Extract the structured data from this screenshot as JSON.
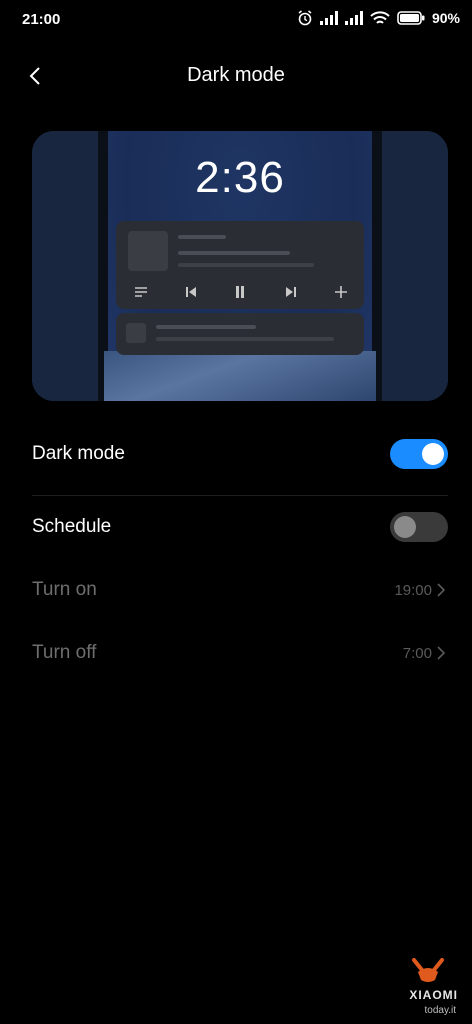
{
  "status_bar": {
    "time": "21:00",
    "battery_percent": "90%",
    "icons": [
      "alarm-icon",
      "signal-icon",
      "signal-icon",
      "wifi-icon",
      "battery-icon"
    ]
  },
  "header": {
    "title": "Dark mode",
    "back_icon": "chevron-left-icon"
  },
  "preview": {
    "clock": "2:36",
    "media_controls": [
      "playlist-icon",
      "previous-icon",
      "pause-icon",
      "next-icon",
      "plus-icon"
    ]
  },
  "settings": {
    "dark_mode": {
      "label": "Dark mode",
      "enabled": true
    },
    "schedule": {
      "label": "Schedule",
      "enabled": false
    },
    "turn_on": {
      "label": "Turn on",
      "value": "19:00"
    },
    "turn_off": {
      "label": "Turn off",
      "value": "7:00"
    }
  },
  "watermark": {
    "brand": "XIAOMI",
    "site": "today.it"
  },
  "colors": {
    "accent": "#1a8cff",
    "background": "#000000",
    "disabled_text": "#6e6e6e"
  }
}
